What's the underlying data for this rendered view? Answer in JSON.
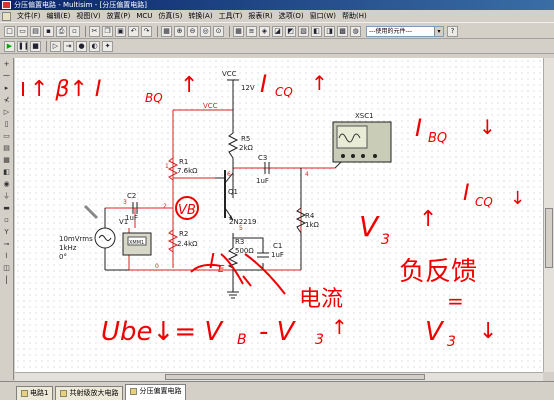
{
  "window": {
    "title": "分压偏置电路 - Multisim - [分压偏置电路]"
  },
  "menu": {
    "items": [
      "文件(F)",
      "编辑(E)",
      "视图(V)",
      "放置(P)",
      "MCU",
      "仿真(S)",
      "转换(A)",
      "工具(T)",
      "报表(R)",
      "选项(O)",
      "窗口(W)",
      "帮助(H)"
    ]
  },
  "toolbar": {
    "component_combo": "---使用的元件---",
    "help_btn": "?"
  },
  "schematic": {
    "vcc_label": "VCC",
    "vcc_voltage": "12V",
    "vcc_net_label": "VCC",
    "r5": {
      "ref": "R5",
      "value": "2kΩ"
    },
    "r1": {
      "ref": "R1",
      "value": "7.6kΩ"
    },
    "r2": {
      "ref": "R2",
      "value": "2.4kΩ"
    },
    "r3": {
      "ref": "R3",
      "value": "500Ω"
    },
    "r4": {
      "ref": "R4",
      "value": "1kΩ"
    },
    "c1": {
      "ref": "C1",
      "value": "1uF"
    },
    "c2": {
      "ref": "C2",
      "value": "1uF"
    },
    "c3": {
      "ref": "C3",
      "value": "1uF"
    },
    "q1": {
      "ref": "Q1",
      "model": "2N2219"
    },
    "v1": {
      "ref": "V1",
      "amp": "10mVrms",
      "freq": "1kHz",
      "phase": "0°"
    },
    "xsc1": {
      "ref": "XSC1",
      "meter_label": "XMM1"
    },
    "nodes": [
      "3",
      "2",
      "1",
      "6",
      "5",
      "4",
      "0"
    ]
  },
  "annotations": {
    "beta_up": "↑ β↑ I",
    "ibq_sub": "BQ",
    "ibq_arrow": "↑",
    "icq_up": "I",
    "icq_sub": "CQ",
    "icq_arrow": "↑",
    "vb_circle": "VB",
    "ibq_down_main": "I",
    "ibq_down_sub": "BQ",
    "ibq_down_arrow": "↓",
    "icq_down_main": "I",
    "icq_down_sub": "CQ",
    "icq_down_arrow": "↓",
    "v3_up_main": "V",
    "v3_up_sub": "3",
    "v3_up_arrow": "↑",
    "current_label": "电流",
    "feedback_label": "负反馈",
    "negfb_mid": "=",
    "ube_eq_main": "Ube↓= V",
    "ube_eq_sub": "B",
    "ube_eq_rest": "- V",
    "ube_eq_sub2": "3",
    "ube_eq_arrow": "↑",
    "v3_down_main": "V",
    "v3_down_sub": "3",
    "v3_down_arrow": "↓",
    "ie_label": "I",
    "ie_sub": "E"
  },
  "tabs": [
    "电路1",
    "共射级放大电路",
    "分压偏置电路"
  ],
  "colors": {
    "annotation": "#e00000",
    "wire_red": "#d22",
    "wire_dark": "#222",
    "title_blue": "#0a246a"
  }
}
